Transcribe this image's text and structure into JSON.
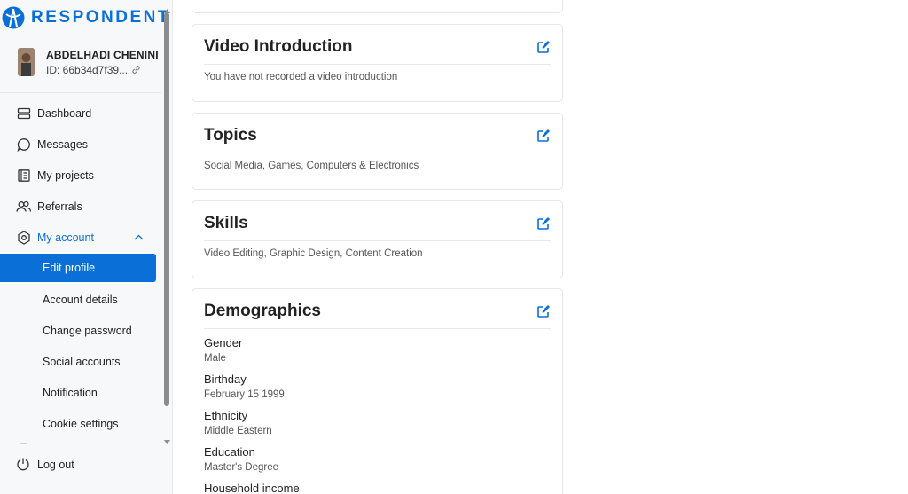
{
  "brand": {
    "name": "RESPONDENT",
    "color": "#0a6fd6"
  },
  "user": {
    "name": "ABDELHADI CHENINI",
    "id": "ID: 66b34d7f39..."
  },
  "nav": {
    "dashboard": "Dashboard",
    "messages": "Messages",
    "projects": "My projects",
    "referrals": "Referrals",
    "account": "My account",
    "sub": {
      "edit_profile": "Edit profile",
      "account_details": "Account details",
      "change_password": "Change password",
      "social_accounts": "Social accounts",
      "notification": "Notification",
      "cookie_settings": "Cookie settings"
    },
    "logout": "Log out"
  },
  "cards": {
    "video": {
      "title": "Video Introduction",
      "text": "You have not recorded a video introduction"
    },
    "topics": {
      "title": "Topics",
      "text": "Social Media, Games, Computers & Electronics"
    },
    "skills": {
      "title": "Skills",
      "text": "Video Editing, Graphic Design, Content Creation"
    },
    "demographics": {
      "title": "Demographics",
      "items": [
        {
          "label": "Gender",
          "value": "Male"
        },
        {
          "label": "Birthday",
          "value": "February 15 1999"
        },
        {
          "label": "Ethnicity",
          "value": "Middle Eastern"
        },
        {
          "label": "Education",
          "value": "Master's Degree"
        },
        {
          "label": "Household income",
          "value": ""
        }
      ]
    }
  },
  "icons": {
    "edit": "edit-icon",
    "dashboard": "dashboard-icon",
    "messages": "chat-bubble-icon",
    "projects": "clipboard-icon",
    "referrals": "people-icon",
    "account": "hexagon-gear-icon",
    "logout": "power-icon",
    "link": "link-icon"
  }
}
